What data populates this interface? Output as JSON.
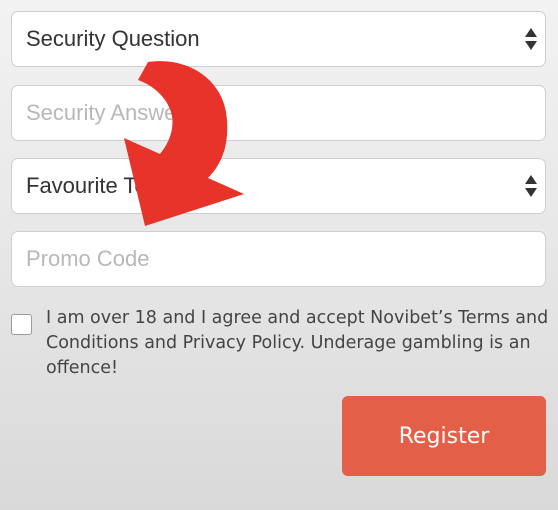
{
  "form": {
    "security_question": {
      "value": "Security Question",
      "icon": "up-down-caret-icon"
    },
    "security_answer": {
      "placeholder": "Security Answer"
    },
    "favourite_team": {
      "value": "Favourite Team",
      "icon": "up-down-caret-icon"
    },
    "promo_code": {
      "placeholder": "Promo Code"
    },
    "terms": {
      "checked": false,
      "text": "I am over 18 and I agree and accept Novibet’s Terms and Conditions and Privacy Policy. Underage gambling is an offence!"
    },
    "register_label": "Register"
  },
  "annotation": {
    "icon": "curved-arrow-icon",
    "color": "#e8332a"
  },
  "colors": {
    "accent": "#e45f48",
    "arrow": "#e8332a",
    "text": "#444444",
    "placeholder": "#b8b8b8"
  }
}
